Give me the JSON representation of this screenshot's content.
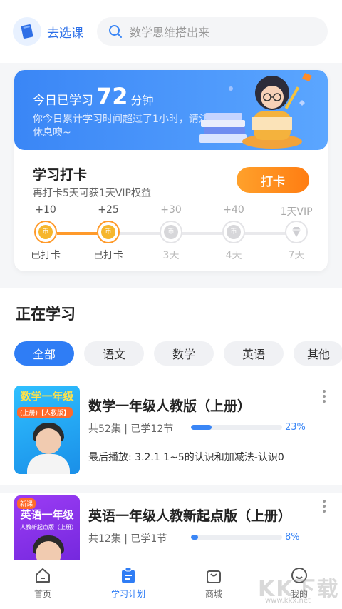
{
  "header": {
    "course_label": "去选课",
    "search_placeholder": "数学思维搭出来"
  },
  "study_banner": {
    "prefix": "今日已学习",
    "minutes": "72",
    "unit": "分钟",
    "message": "你今日累计学习时间超过了1小时，请注意休息噢~"
  },
  "checkin": {
    "title": "学习打卡",
    "subtitle": "再打卡5天可获1天VIP权益",
    "button": "打卡",
    "steps": [
      {
        "reward": "+10",
        "label": "已打卡",
        "done": true
      },
      {
        "reward": "+25",
        "label": "已打卡",
        "done": true
      },
      {
        "reward": "+30",
        "label": "3天",
        "done": false
      },
      {
        "reward": "+40",
        "label": "4天",
        "done": false
      },
      {
        "reward": "1天VIP",
        "label": "7天",
        "done": false
      }
    ]
  },
  "learning": {
    "title": "正在学习",
    "filters": [
      "全部",
      "语文",
      "数学",
      "英语",
      "其他"
    ],
    "active_filter": "全部",
    "courses": [
      {
        "title": "数学一年级人教版（上册）",
        "meta": "共52集 | 已学12节",
        "progress": 23,
        "progress_label": "23%",
        "last_played": "最后播放: 3.2.1 1~5的认识和加减法-认识0",
        "thumb_title": "数学一年级",
        "thumb_sub": "(上册)【人教版】",
        "thumb_color": "#27b2f5"
      },
      {
        "title": "英语一年级人教新起点版（上册）",
        "meta": "共12集 | 已学1节",
        "progress": 8,
        "progress_label": "8%",
        "thumb_badge": "新课",
        "thumb_title": "英语一年级",
        "thumb_sub": "人教新起点版（上册）",
        "thumb_color": "#8a3cf0"
      }
    ]
  },
  "tabbar": {
    "items": [
      "首页",
      "学习计划",
      "商城",
      "我的"
    ],
    "active": "学习计划"
  },
  "watermark": {
    "text": "KK下载",
    "url": "www.kkx.net"
  },
  "colors": {
    "primary": "#2f7df5",
    "orange": "#ff8a1c"
  }
}
